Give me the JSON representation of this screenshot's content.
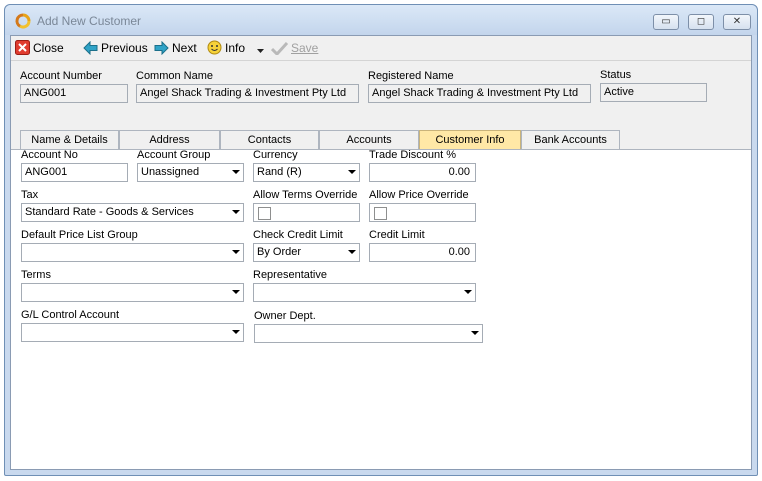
{
  "window": {
    "title": "Add New Customer",
    "minimize_glyph": "▭",
    "maximize_glyph": "◻",
    "close_glyph": "✕"
  },
  "toolbar": {
    "close_label": "Close",
    "previous_label": "Previous",
    "next_label": "Next",
    "info_label": "Info",
    "save_label": "Save"
  },
  "header": {
    "account_number_label": "Account Number",
    "account_number_value": "ANG001",
    "common_name_label": "Common Name",
    "common_name_value": "Angel Shack Trading & Investment Pty Ltd",
    "registered_name_label": "Registered Name",
    "registered_name_value": "Angel Shack Trading & Investment Pty Ltd",
    "status_label": "Status",
    "status_value": "Active"
  },
  "tabs": [
    {
      "label": "Name & Details"
    },
    {
      "label": "Address"
    },
    {
      "label": "Contacts"
    },
    {
      "label": "Accounts"
    },
    {
      "label": "Customer Info"
    },
    {
      "label": "Bank Accounts"
    }
  ],
  "active_tab": "Customer Info",
  "form": {
    "account_no_label": "Account No",
    "account_no_value": "ANG001",
    "account_group_label": "Account Group",
    "account_group_value": "Unassigned",
    "currency_label": "Currency",
    "currency_value": "Rand (R)",
    "trade_discount_label": "Trade Discount %",
    "trade_discount_value": "0.00",
    "tax_label": "Tax",
    "tax_value": "Standard Rate - Goods & Services",
    "allow_terms_override_label": "Allow Terms Override",
    "allow_terms_override_checked": false,
    "allow_price_override_label": "Allow Price Override",
    "allow_price_override_checked": false,
    "default_price_list_group_label": "Default Price List Group",
    "default_price_list_group_value": "",
    "check_credit_limit_label": "Check Credit Limit",
    "check_credit_limit_value": "By Order",
    "credit_limit_label": "Credit Limit",
    "credit_limit_value": "0.00",
    "terms_label": "Terms",
    "terms_value": "",
    "representative_label": "Representative",
    "representative_value": "",
    "gl_control_account_label": "G/L Control Account",
    "gl_control_account_value": "",
    "owner_dept_label": "Owner Dept.",
    "owner_dept_value": ""
  },
  "colors": {
    "active_tab": "#ffe8a6",
    "window_frame": "#c9d9ee",
    "panel": "#f0f0f0"
  }
}
